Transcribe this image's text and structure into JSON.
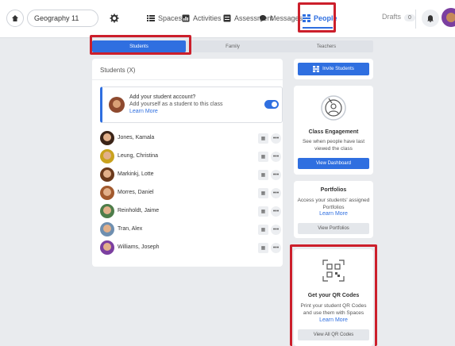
{
  "topbar": {
    "class_name": "Geography 11",
    "nav": {
      "spaces": "Spaces",
      "activities": "Activities",
      "assessment": "Assessment",
      "messages": "Messages",
      "people": "People"
    },
    "drafts_label": "Drafts",
    "drafts_count": "0"
  },
  "tabs": {
    "students": "Students",
    "family": "Family",
    "teachers": "Teachers"
  },
  "students_panel": {
    "title": "Students (X)",
    "add_account": {
      "heading": "Add your student account?",
      "text": "Add yourself as a student to this class",
      "link": "Learn More"
    },
    "students": [
      {
        "name": "Jones, Kamala"
      },
      {
        "name": "Leung, Christina"
      },
      {
        "name": "Markinkj, Lotte"
      },
      {
        "name": "Morres, Daniel"
      },
      {
        "name": "Reinholdt, Jaime"
      },
      {
        "name": "Tran, Alex"
      },
      {
        "name": "Williams, Joseph"
      }
    ]
  },
  "sidebar": {
    "invite_button": "Invite Students",
    "engagement": {
      "title": "Class Engagement",
      "text": "See when people have last viewed the class",
      "button": "View Dashboard"
    },
    "portfolios": {
      "title": "Portfolios",
      "text": "Access your students' assigned Portfolios",
      "link": "Learn More",
      "button": "View Portfolios"
    },
    "qr": {
      "title": "Get your QR Codes",
      "text": "Print your student QR Codes and use them with Spaces",
      "link": "Learn More",
      "button": "View All QR Codes"
    }
  },
  "colors": {
    "accent": "#2f6fe0",
    "highlight": "#cc1f2b",
    "background": "#e9ebee"
  }
}
